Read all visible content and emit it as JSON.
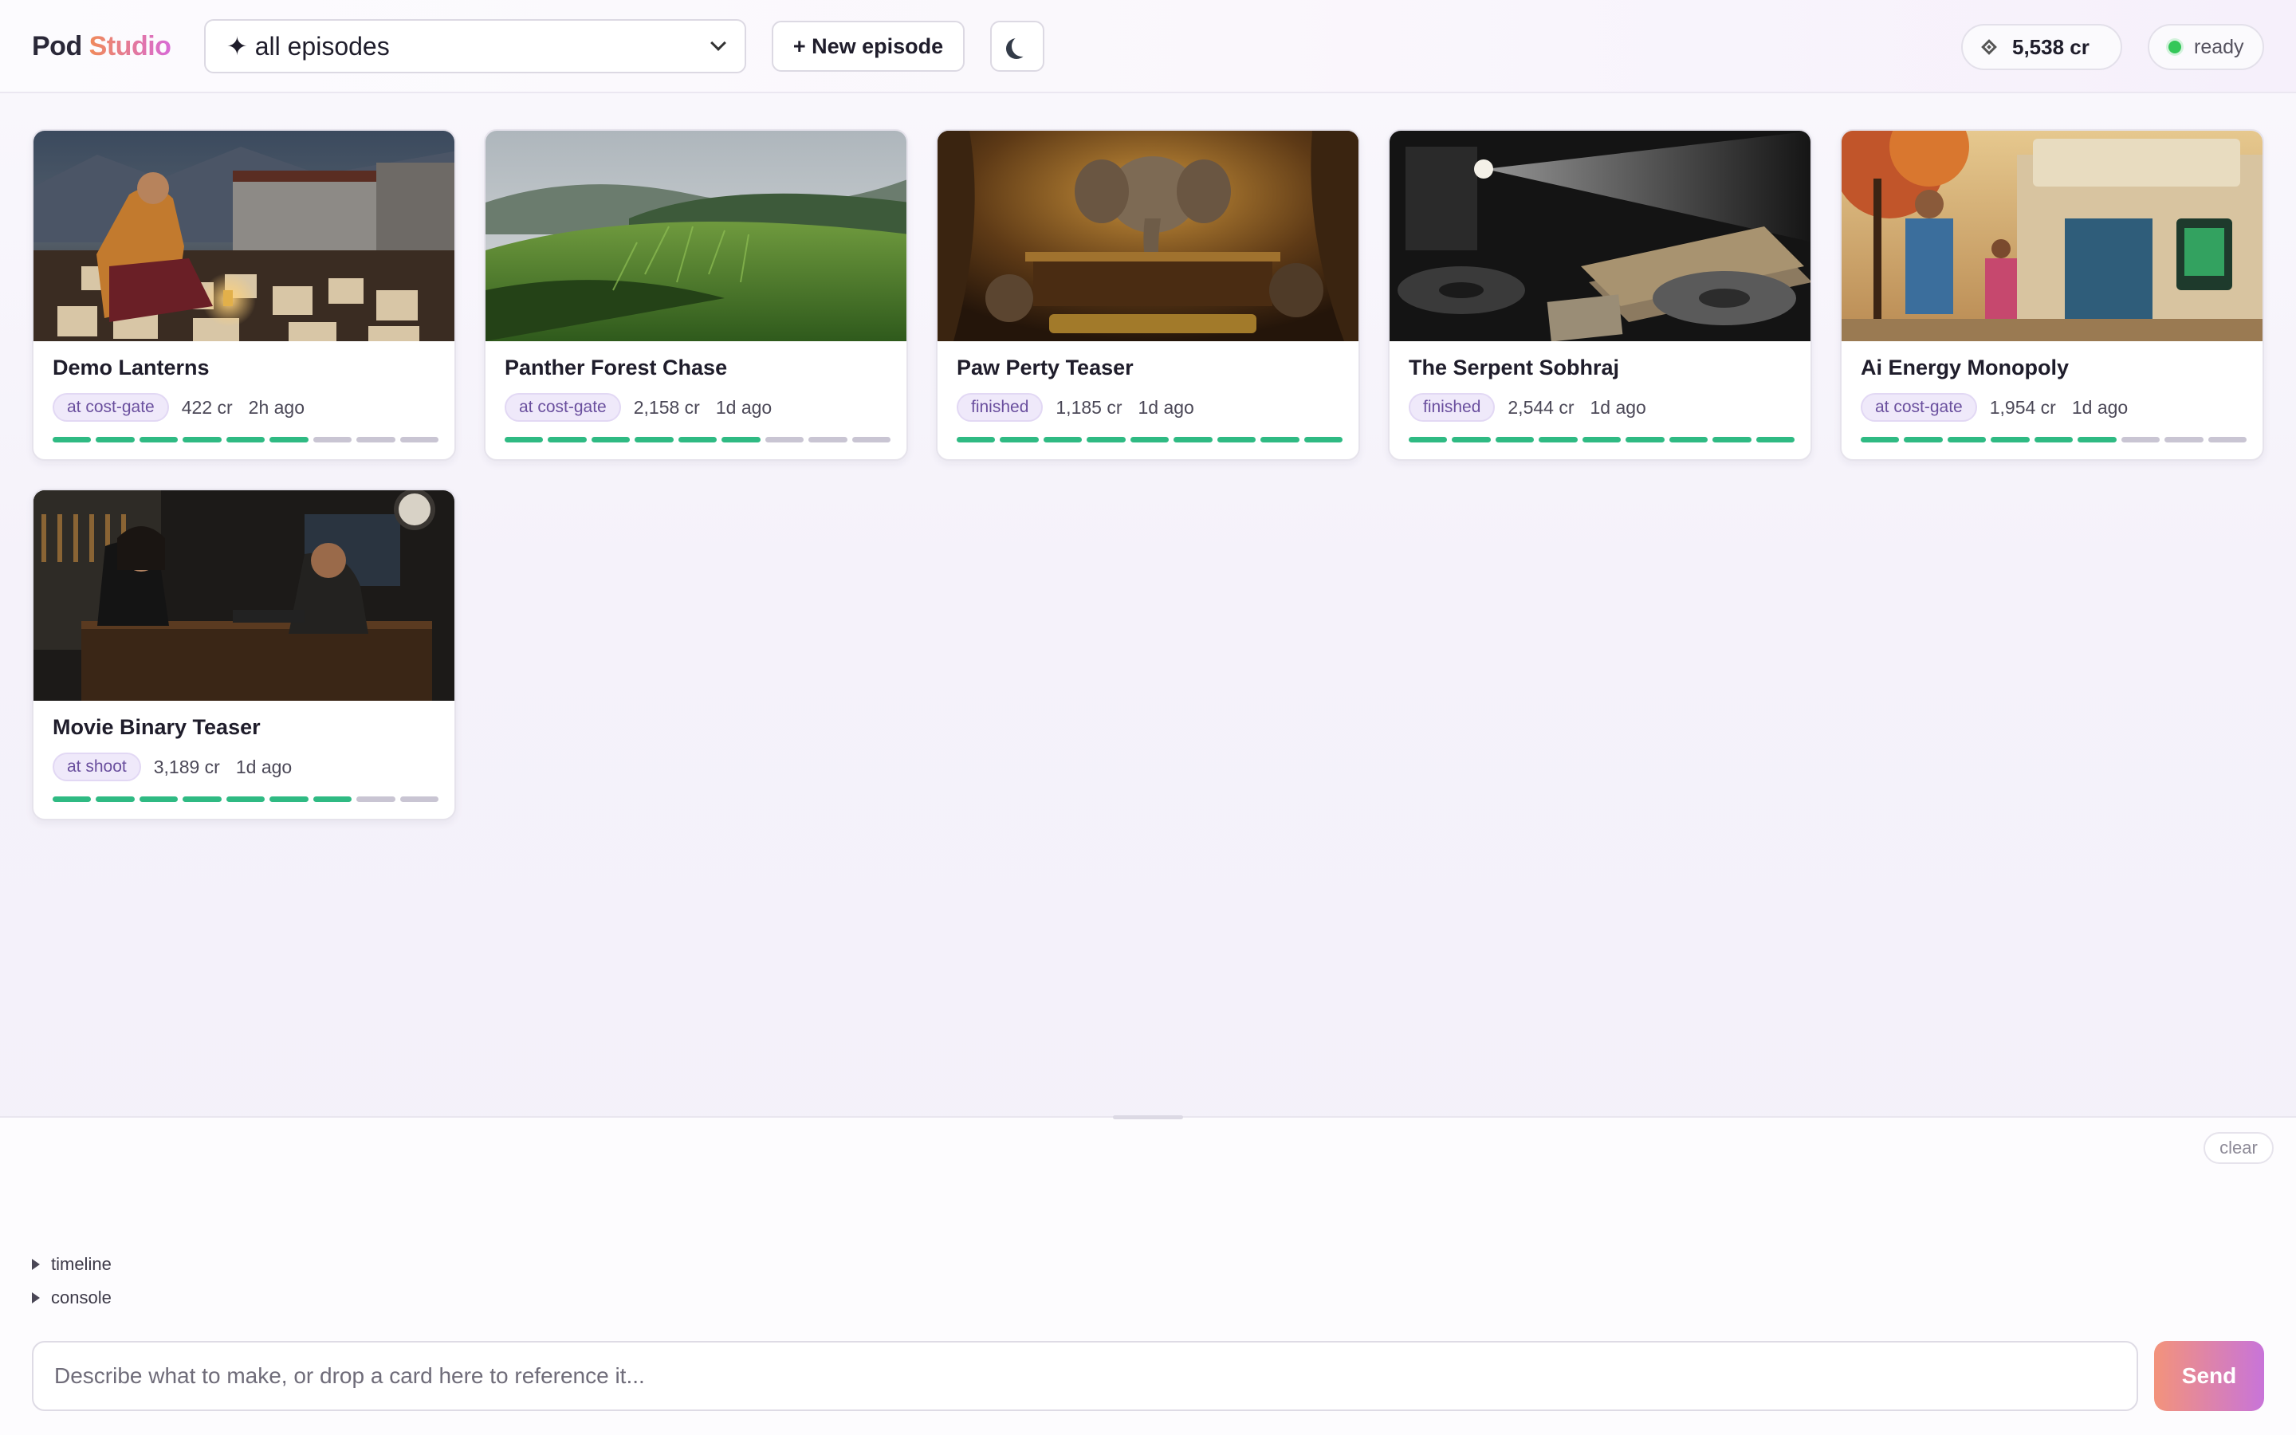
{
  "app": {
    "logo_part1": "Pod",
    "logo_part2": "Studio"
  },
  "header": {
    "episode_filter": "✦ all episodes",
    "new_episode_label": "+ New episode",
    "theme_icon": "moon-icon",
    "credits_label": "5,538 cr",
    "credits_icon": "diamond-icon",
    "status_label": "ready",
    "status_color": "#34c759"
  },
  "episodes": [
    {
      "title": "Demo Lanterns",
      "stage": "at cost-gate",
      "cost": "422 cr",
      "age": "2h ago",
      "progress": {
        "done": 6,
        "total": 9
      }
    },
    {
      "title": "Panther Forest Chase",
      "stage": "at cost-gate",
      "cost": "2,158 cr",
      "age": "1d ago",
      "progress": {
        "done": 6,
        "total": 9
      }
    },
    {
      "title": "Paw Perty Teaser",
      "stage": "finished",
      "cost": "1,185 cr",
      "age": "1d ago",
      "progress": {
        "done": 9,
        "total": 9
      }
    },
    {
      "title": "The Serpent Sobhraj",
      "stage": "finished",
      "cost": "2,544 cr",
      "age": "1d ago",
      "progress": {
        "done": 9,
        "total": 9
      }
    },
    {
      "title": "Ai Energy Monopoly",
      "stage": "at cost-gate",
      "cost": "1,954 cr",
      "age": "1d ago",
      "progress": {
        "done": 6,
        "total": 9
      }
    },
    {
      "title": "Movie Binary Teaser",
      "stage": "at shoot",
      "cost": "3,189 cr",
      "age": "1d ago",
      "progress": {
        "done": 7,
        "total": 9
      }
    }
  ],
  "panel": {
    "clear_label": "clear",
    "timeline_label": "timeline",
    "console_label": "console",
    "prompt_placeholder": "Describe what to make, or drop a card here to reference it...",
    "send_label": "Send"
  },
  "colors": {
    "accent_green": "#2fba83",
    "pending_gray": "#c9c5d3",
    "badge_bg": "#efe9fa",
    "badge_text": "#6a4f9e"
  }
}
